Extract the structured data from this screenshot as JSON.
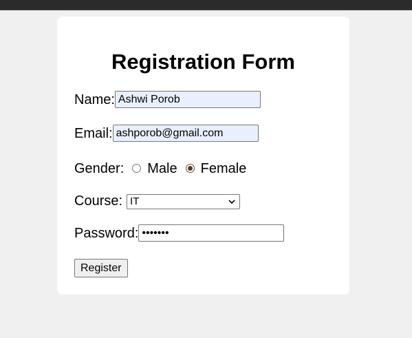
{
  "form": {
    "title": "Registration Form",
    "name": {
      "label": "Name:",
      "value": "Ashwi Porob"
    },
    "email": {
      "label": "Email:",
      "value": "ashporob@gmail.com"
    },
    "gender": {
      "label": "Gender:",
      "options": [
        {
          "label": "Male",
          "checked": false
        },
        {
          "label": "Female",
          "checked": true
        }
      ]
    },
    "course": {
      "label": "Course:",
      "selected": "IT"
    },
    "password": {
      "label": "Password:",
      "masked_value": "•••••••"
    },
    "register_label": "Register"
  },
  "colors": {
    "page_background": "#f0f0f0",
    "card_background": "#ffffff",
    "autofill_background": "#e8f0fe",
    "top_bar": "#2b2b2b",
    "radio_checked": "#5a3a24"
  },
  "icons": {
    "course_dropdown": "chevron-down-icon"
  }
}
